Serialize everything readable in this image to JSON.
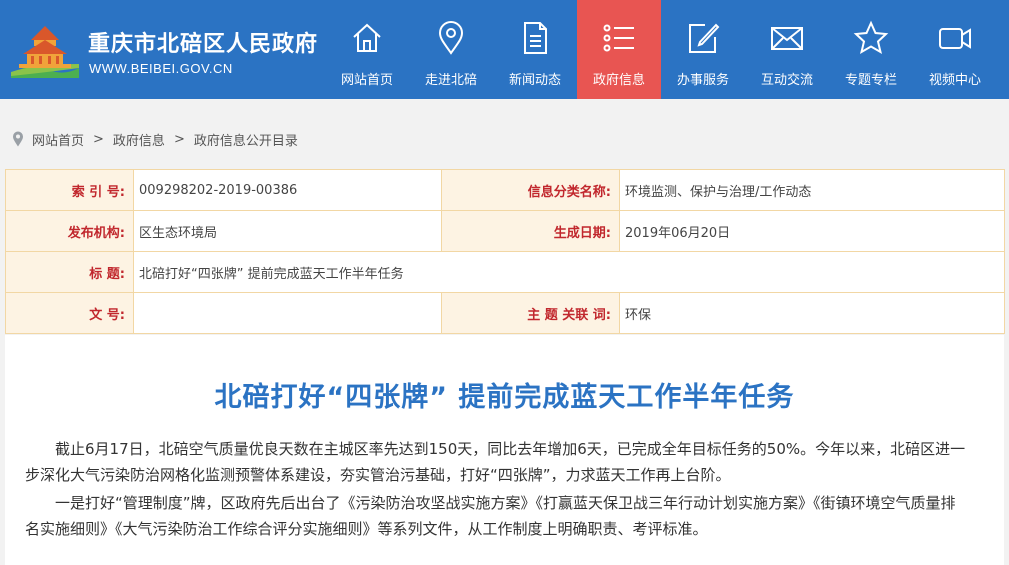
{
  "header": {
    "site_title": "重庆市北碚区人民政府",
    "site_url": "WWW.BEIBEI.GOV.CN",
    "nav": [
      {
        "label": "网站首页",
        "icon": "home-icon"
      },
      {
        "label": "走进北碚",
        "icon": "location-pin-icon"
      },
      {
        "label": "新闻动态",
        "icon": "document-icon"
      },
      {
        "label": "政府信息",
        "icon": "list-icon",
        "active": true
      },
      {
        "label": "办事服务",
        "icon": "edit-icon"
      },
      {
        "label": "互动交流",
        "icon": "mail-icon"
      },
      {
        "label": "专题专栏",
        "icon": "star-icon"
      },
      {
        "label": "视频中心",
        "icon": "video-icon"
      }
    ],
    "colors": {
      "bar": "#2b73c3",
      "active": "#e85552"
    }
  },
  "breadcrumb": {
    "items": [
      "网站首页",
      "政府信息",
      "政府信息公开目录"
    ],
    "separator": ">"
  },
  "info": {
    "index_label": "索 引 号:",
    "index_value": "009298202-2019-00386",
    "category_label": "信息分类名称:",
    "category_value": "环境监测、保护与治理/工作动态",
    "publisher_label": "发布机构:",
    "publisher_value": "区生态环境局",
    "date_label": "生成日期:",
    "date_value": "2019年06月20日",
    "title_label": "标 题:",
    "title_value": "北碚打好“四张牌” 提前完成蓝天工作半年任务",
    "docno_label": "文 号:",
    "docno_value": "",
    "keywords_label": "主 题 关联 词:",
    "keywords_value": "环保"
  },
  "article": {
    "title": "北碚打好“四张牌” 提前完成蓝天工作半年任务",
    "paragraphs": [
      "截止6月17日，北碚空气质量优良天数在主城区率先达到150天，同比去年增加6天，已完成全年目标任务的50%。今年以来，北碚区进一步深化大气污染防治网格化监测预警体系建设，夯实管治污基础，打好“四张牌”，力求蓝天工作再上台阶。",
      "一是打好“管理制度”牌，区政府先后出台了《污染防治攻坚战实施方案》《打赢蓝天保卫战三年行动计划实施方案》《街镇环境空气质量排名实施细则》《大气污染防治工作综合评分实施细则》等系列文件，从工作制度上明确职责、考评标准。"
    ]
  }
}
